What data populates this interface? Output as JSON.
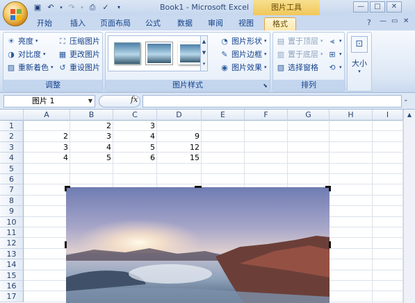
{
  "window": {
    "title": "Book1 - Microsoft Excel",
    "tool_tab_title": "图片工具",
    "controls": [
      "—",
      "□",
      "✕"
    ]
  },
  "tabs": [
    {
      "label": "开始"
    },
    {
      "label": "插入"
    },
    {
      "label": "页面布局"
    },
    {
      "label": "公式"
    },
    {
      "label": "数据"
    },
    {
      "label": "审阅"
    },
    {
      "label": "视图"
    },
    {
      "label": "格式",
      "active": true
    }
  ],
  "ribbon": {
    "adjust": {
      "label": "调整",
      "brightness": "亮度",
      "contrast": "对比度",
      "recolor": "重新着色",
      "compress": "压缩图片",
      "change": "更改图片",
      "reset": "重设图片"
    },
    "styles": {
      "label": "图片样式",
      "shape": "图片形状",
      "border": "图片边框",
      "effects": "图片效果"
    },
    "arrange": {
      "label": "排列",
      "bring_front": "置于顶层",
      "send_back": "置于底层",
      "selection_pane": "选择窗格"
    },
    "size": {
      "label": "大小"
    }
  },
  "formula_bar": {
    "name_box": "图片 1",
    "fx": "fx",
    "formula": ""
  },
  "grid": {
    "columns": [
      "A",
      "B",
      "C",
      "D",
      "E",
      "F",
      "G",
      "H",
      "I"
    ],
    "rows": [
      "1",
      "2",
      "3",
      "4",
      "5",
      "6",
      "7",
      "8",
      "9",
      "10",
      "11",
      "12",
      "13",
      "14",
      "15",
      "16",
      "17"
    ],
    "cells": {
      "B1": "2",
      "C1": "3",
      "A2": "2",
      "B2": "3",
      "C2": "4",
      "D2": "9",
      "A3": "3",
      "B3": "4",
      "C3": "5",
      "D3": "12",
      "A4": "4",
      "B4": "5",
      "C4": "6",
      "D4": "15"
    }
  },
  "colors": {
    "accent": "#e6a23a",
    "ribbon": "#dce7f5"
  }
}
